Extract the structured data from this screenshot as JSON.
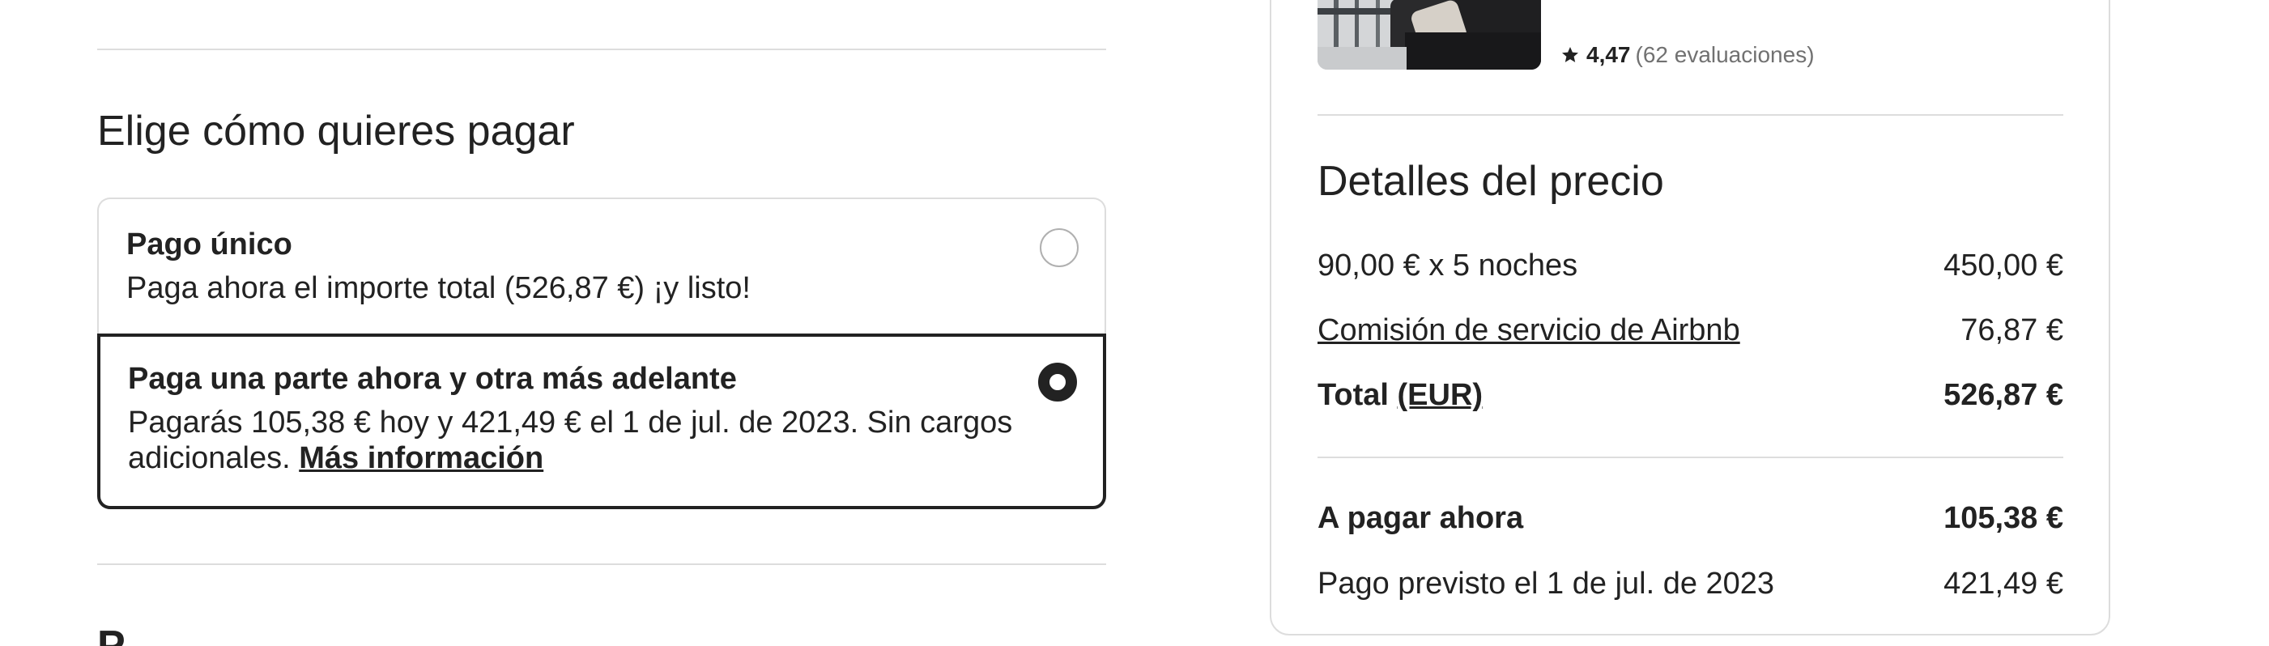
{
  "payment": {
    "title": "Elige cómo quieres pagar",
    "options": [
      {
        "title": "Pago único",
        "description": "Paga ahora el importe total (526,87 €) ¡y listo!",
        "selected": false
      },
      {
        "title": "Paga una parte ahora y otra más adelante",
        "description": "Pagarás 105,38 € hoy y 421,49 € el 1 de jul. de 2023. Sin cargos adicionales.",
        "link": "Más información",
        "selected": true
      }
    ],
    "next_section_title": "P"
  },
  "listing": {
    "rating": "4,47",
    "reviews": "(62 evaluaciones)"
  },
  "price_details": {
    "title": "Detalles del precio",
    "rows": [
      {
        "label": "90,00 € x 5 noches",
        "value": "450,00 €"
      },
      {
        "label": "Comisión de servicio de Airbnb",
        "value": "76,87 €"
      }
    ],
    "total": {
      "label": "Total",
      "currency": "(EUR)",
      "value": "526,87 €"
    },
    "pay_now": {
      "label": "A pagar ahora",
      "value": "105,38 €"
    },
    "scheduled": {
      "label": "Pago previsto el 1 de jul. de 2023",
      "value": "421,49 €"
    }
  },
  "colors": {
    "text": "#222222",
    "muted": "#717171",
    "divider": "#dddddd"
  }
}
